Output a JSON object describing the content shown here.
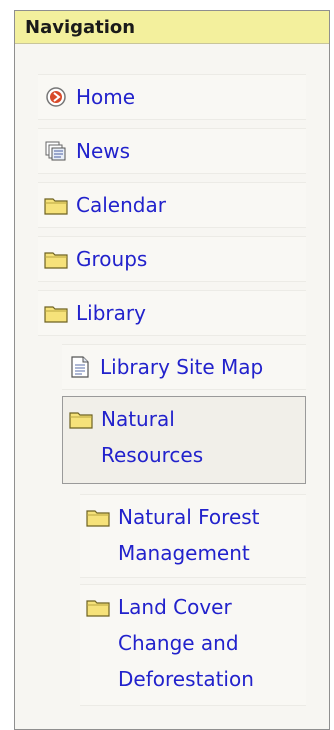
{
  "portlet": {
    "title": "Navigation"
  },
  "nav": {
    "items": [
      {
        "label": "Home",
        "icon": "home-icon"
      },
      {
        "label": "News",
        "icon": "news-icon"
      },
      {
        "label": "Calendar",
        "icon": "folder-icon"
      },
      {
        "label": "Groups",
        "icon": "folder-icon"
      },
      {
        "label": "Library",
        "icon": "folder-icon"
      },
      {
        "label": "Library Site Map",
        "icon": "document-icon"
      },
      {
        "label": "Natural Resources",
        "icon": "folder-icon",
        "selected": true
      },
      {
        "label": "Natural Forest Management",
        "icon": "folder-icon"
      },
      {
        "label": "Land Cover Change and Deforestation",
        "icon": "folder-icon"
      }
    ]
  },
  "colors": {
    "header_bg": "#f3f09d",
    "link": "#2222cc",
    "panel_bg": "#f7f6f2"
  }
}
